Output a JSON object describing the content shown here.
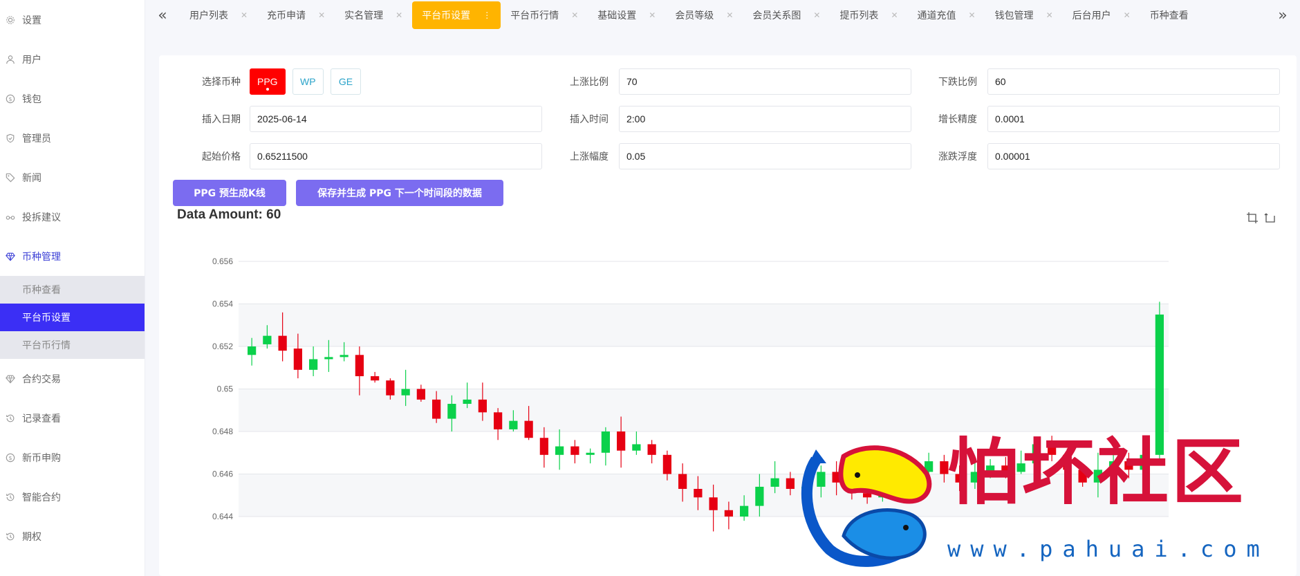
{
  "sidebar": {
    "items": [
      {
        "label": "设置",
        "icon": "gear-icon"
      },
      {
        "label": "用户",
        "icon": "user-icon"
      },
      {
        "label": "钱包",
        "icon": "dollar-icon"
      },
      {
        "label": "管理员",
        "icon": "shield-icon"
      },
      {
        "label": "新闻",
        "icon": "tag-icon"
      },
      {
        "label": "投拆建议",
        "icon": "link-icon"
      },
      {
        "label": "币种管理",
        "icon": "diamond-icon"
      },
      {
        "label": "合约交易",
        "icon": "diamond-icon"
      },
      {
        "label": "记录查看",
        "icon": "history-icon"
      },
      {
        "label": "新币申购",
        "icon": "dollar-icon"
      },
      {
        "label": "智能合约",
        "icon": "history-icon"
      },
      {
        "label": "期权",
        "icon": "history-icon"
      }
    ],
    "submenu": [
      {
        "label": "币种查看"
      },
      {
        "label": "平台币设置"
      },
      {
        "label": "平台币行情"
      }
    ],
    "active_color": "#3b2ff5"
  },
  "tabs": [
    {
      "label": "用户列表"
    },
    {
      "label": "充币申请"
    },
    {
      "label": "实名管理"
    },
    {
      "label": "平台币设置"
    },
    {
      "label": "平台币行情"
    },
    {
      "label": "基础设置"
    },
    {
      "label": "会员等级"
    },
    {
      "label": "会员关系图"
    },
    {
      "label": "提币列表"
    },
    {
      "label": "通道充值"
    },
    {
      "label": "钱包管理"
    },
    {
      "label": "后台用户"
    },
    {
      "label": "币种查看"
    }
  ],
  "active_tab_color": "#ffb400",
  "form": {
    "coin_label": "选择币种",
    "coins": [
      "PPG",
      "WP",
      "GE"
    ],
    "selected_coin": "PPG",
    "rise_ratio_label": "上涨比例",
    "rise_ratio": "70",
    "fall_ratio_label": "下跌比例",
    "fall_ratio": "60",
    "insert_date_label": "插入日期",
    "insert_date": "2025-06-14",
    "insert_time_label": "插入时间",
    "insert_time": "2:00",
    "growth_precision_label": "增长精度",
    "growth_precision": "0.0001",
    "start_price_label": "起始价格",
    "start_price": "0.65211500",
    "rise_range_label": "上涨幅度",
    "rise_range": "0.05",
    "float_label": "涨跌浮度",
    "float": "0.00001"
  },
  "buttons": {
    "pregen": "PPG 预生成K线",
    "save_gen": "保存并生成 PPG 下一个时间段的数据"
  },
  "data_amount": "Data Amount: 60",
  "chart_data": {
    "type": "candlestick",
    "y_ticks": [
      "0.656",
      "0.654",
      "0.652",
      "0.65",
      "0.648",
      "0.646",
      "0.644"
    ],
    "ylim": [
      0.643,
      0.656
    ],
    "up_color": "#0bd14b",
    "down_color": "#e60012",
    "candles": [
      {
        "o": 0.6516,
        "c": 0.652,
        "h": 0.6524,
        "l": 0.6511
      },
      {
        "o": 0.6521,
        "c": 0.6525,
        "h": 0.653,
        "l": 0.6519
      },
      {
        "o": 0.6525,
        "c": 0.6518,
        "h": 0.6536,
        "l": 0.6513
      },
      {
        "o": 0.6519,
        "c": 0.6509,
        "h": 0.6526,
        "l": 0.6505
      },
      {
        "o": 0.6509,
        "c": 0.6514,
        "h": 0.652,
        "l": 0.6506
      },
      {
        "o": 0.6514,
        "c": 0.6515,
        "h": 0.6523,
        "l": 0.6508
      },
      {
        "o": 0.6515,
        "c": 0.6516,
        "h": 0.6522,
        "l": 0.6513
      },
      {
        "o": 0.6516,
        "c": 0.6506,
        "h": 0.652,
        "l": 0.6497
      },
      {
        "o": 0.6506,
        "c": 0.6504,
        "h": 0.6508,
        "l": 0.6503
      },
      {
        "o": 0.6504,
        "c": 0.6497,
        "h": 0.6505,
        "l": 0.6495
      },
      {
        "o": 0.6497,
        "c": 0.65,
        "h": 0.6509,
        "l": 0.6492
      },
      {
        "o": 0.65,
        "c": 0.6495,
        "h": 0.6502,
        "l": 0.6494
      },
      {
        "o": 0.6495,
        "c": 0.6486,
        "h": 0.6499,
        "l": 0.6484
      },
      {
        "o": 0.6486,
        "c": 0.6493,
        "h": 0.6497,
        "l": 0.648
      },
      {
        "o": 0.6493,
        "c": 0.6495,
        "h": 0.6503,
        "l": 0.6491
      },
      {
        "o": 0.6495,
        "c": 0.6489,
        "h": 0.6503,
        "l": 0.6485
      },
      {
        "o": 0.6489,
        "c": 0.6481,
        "h": 0.6491,
        "l": 0.6476
      },
      {
        "o": 0.6481,
        "c": 0.6485,
        "h": 0.649,
        "l": 0.648
      },
      {
        "o": 0.6485,
        "c": 0.6477,
        "h": 0.6492,
        "l": 0.6476
      },
      {
        "o": 0.6477,
        "c": 0.6469,
        "h": 0.6482,
        "l": 0.6463
      },
      {
        "o": 0.6469,
        "c": 0.6473,
        "h": 0.6481,
        "l": 0.6462
      },
      {
        "o": 0.6473,
        "c": 0.6469,
        "h": 0.6476,
        "l": 0.6465
      },
      {
        "o": 0.6469,
        "c": 0.647,
        "h": 0.6472,
        "l": 0.6465
      },
      {
        "o": 0.647,
        "c": 0.648,
        "h": 0.6482,
        "l": 0.6464
      },
      {
        "o": 0.648,
        "c": 0.6471,
        "h": 0.6487,
        "l": 0.6463
      },
      {
        "o": 0.6471,
        "c": 0.6474,
        "h": 0.648,
        "l": 0.6469
      },
      {
        "o": 0.6474,
        "c": 0.6469,
        "h": 0.6476,
        "l": 0.6465
      },
      {
        "o": 0.6469,
        "c": 0.646,
        "h": 0.6471,
        "l": 0.6457
      },
      {
        "o": 0.646,
        "c": 0.6453,
        "h": 0.6465,
        "l": 0.6447
      },
      {
        "o": 0.6453,
        "c": 0.6449,
        "h": 0.6459,
        "l": 0.6443
      },
      {
        "o": 0.6449,
        "c": 0.6443,
        "h": 0.6455,
        "l": 0.6433
      },
      {
        "o": 0.6443,
        "c": 0.644,
        "h": 0.6447,
        "l": 0.6434
      },
      {
        "o": 0.644,
        "c": 0.6445,
        "h": 0.645,
        "l": 0.6438
      },
      {
        "o": 0.6445,
        "c": 0.6454,
        "h": 0.646,
        "l": 0.644
      },
      {
        "o": 0.6454,
        "c": 0.6458,
        "h": 0.6466,
        "l": 0.6451
      },
      {
        "o": 0.6458,
        "c": 0.6453,
        "h": 0.6461,
        "l": 0.645
      },
      {
        "o": 0.6453,
        "c": 0.6454,
        "h": 0.6459,
        "l": 0.6448
      },
      {
        "o": 0.6454,
        "c": 0.6461,
        "h": 0.6464,
        "l": 0.6449
      },
      {
        "o": 0.6461,
        "c": 0.6456,
        "h": 0.6466,
        "l": 0.645
      },
      {
        "o": 0.6456,
        "c": 0.6451,
        "h": 0.6461,
        "l": 0.6448
      },
      {
        "o": 0.6451,
        "c": 0.6449,
        "h": 0.6454,
        "l": 0.6446
      },
      {
        "o": 0.6449,
        "c": 0.6451,
        "h": 0.6456,
        "l": 0.6447
      },
      {
        "o": 0.6451,
        "c": 0.6452,
        "h": 0.6457,
        "l": 0.6449
      },
      {
        "o": 0.6452,
        "c": 0.6461,
        "h": 0.6464,
        "l": 0.645
      },
      {
        "o": 0.6461,
        "c": 0.6466,
        "h": 0.647,
        "l": 0.6459
      },
      {
        "o": 0.6466,
        "c": 0.646,
        "h": 0.6469,
        "l": 0.6456
      },
      {
        "o": 0.646,
        "c": 0.6456,
        "h": 0.6464,
        "l": 0.6452
      },
      {
        "o": 0.6456,
        "c": 0.6461,
        "h": 0.6466,
        "l": 0.6453
      },
      {
        "o": 0.6461,
        "c": 0.6464,
        "h": 0.6467,
        "l": 0.6458
      },
      {
        "o": 0.6464,
        "c": 0.6461,
        "h": 0.6468,
        "l": 0.6458
      },
      {
        "o": 0.6461,
        "c": 0.6465,
        "h": 0.6471,
        "l": 0.646
      },
      {
        "o": 0.6465,
        "c": 0.6474,
        "h": 0.6476,
        "l": 0.6463
      },
      {
        "o": 0.6474,
        "c": 0.6469,
        "h": 0.6478,
        "l": 0.6466
      },
      {
        "o": 0.6469,
        "c": 0.6462,
        "h": 0.6472,
        "l": 0.6458
      },
      {
        "o": 0.6462,
        "c": 0.6456,
        "h": 0.6465,
        "l": 0.6454
      },
      {
        "o": 0.6456,
        "c": 0.6462,
        "h": 0.647,
        "l": 0.6449
      },
      {
        "o": 0.6462,
        "c": 0.6466,
        "h": 0.6471,
        "l": 0.646
      },
      {
        "o": 0.6466,
        "c": 0.6462,
        "h": 0.647,
        "l": 0.6458
      },
      {
        "o": 0.6462,
        "c": 0.6469,
        "h": 0.6474,
        "l": 0.6458
      },
      {
        "o": 0.6469,
        "c": 0.6535,
        "h": 0.6541,
        "l": 0.6466
      }
    ]
  },
  "watermark": {
    "title": "怕坏社区",
    "url": "www.pahuai.com"
  }
}
